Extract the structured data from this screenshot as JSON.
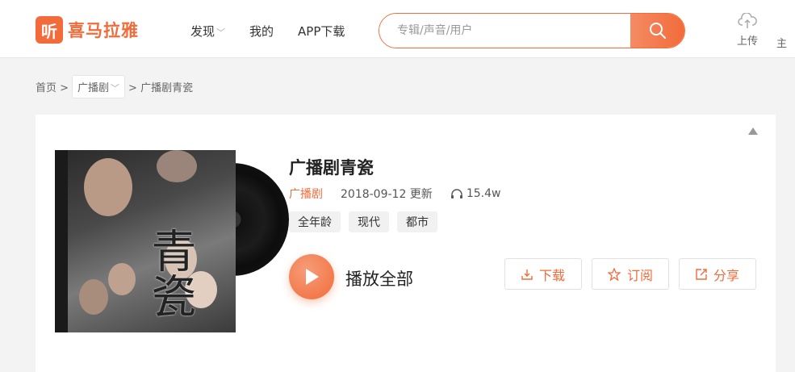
{
  "header": {
    "logo_badge": "听",
    "logo_text": "喜马拉雅",
    "nav": [
      {
        "label": "发现",
        "has_dropdown": true
      },
      {
        "label": "我的"
      },
      {
        "label": "APP下载"
      }
    ],
    "search": {
      "placeholder": "专辑/声音/用户"
    },
    "upload_label": "上传",
    "cut_label": "主"
  },
  "breadcrumb": {
    "home": "首页 >",
    "category": "广播剧",
    "current": "> 广播剧青瓷"
  },
  "album": {
    "cover_text": "青瓷",
    "title": "广播剧青瓷",
    "category": "广播剧",
    "updated": "2018-09-12 更新",
    "plays": "15.4w",
    "tags": [
      "全年龄",
      "现代",
      "都市"
    ],
    "play_all_label": "播放全部",
    "actions": {
      "download": "下载",
      "subscribe": "订阅",
      "share": "分享"
    }
  },
  "colors": {
    "accent": "#f26b3a"
  }
}
